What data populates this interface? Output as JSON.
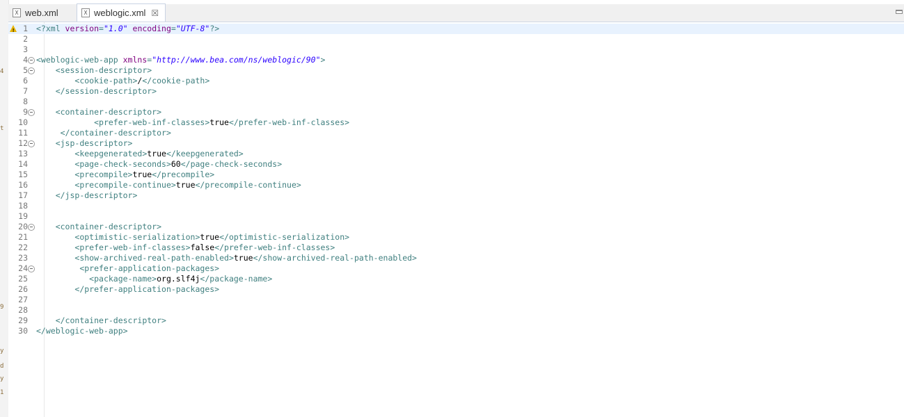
{
  "tabs": [
    {
      "label": "web.xml",
      "icon": "xml-file-icon",
      "active": false
    },
    {
      "label": "weblogic.xml",
      "icon": "xml-file-icon",
      "active": true,
      "close": "☒"
    }
  ],
  "left_strip_glyphs": [
    "4",
    "t",
    "9",
    "y",
    "d",
    "y",
    "1"
  ],
  "colors": {
    "tag": "#3f7f7f",
    "attr": "#7f007f",
    "value": "#2a00ff",
    "current_line": "#e8f2fe",
    "warning": "#e8b400"
  },
  "lines": [
    {
      "num": "1",
      "indent": "",
      "tokens": [
        [
          "pi",
          "<?xml "
        ],
        [
          "attr",
          "version"
        ],
        [
          "tag",
          "="
        ],
        [
          "val",
          "\"1.0\""
        ],
        [
          "tag",
          " "
        ],
        [
          "attr",
          "encoding"
        ],
        [
          "tag",
          "="
        ],
        [
          "val",
          "\"UTF-8\""
        ],
        [
          "pi",
          "?>"
        ]
      ]
    },
    {
      "num": "2",
      "indent": "",
      "tokens": []
    },
    {
      "num": "3",
      "indent": "",
      "tokens": []
    },
    {
      "num": "4",
      "indent": "",
      "tokens": [
        [
          "tag",
          "<weblogic-web-app "
        ],
        [
          "attr",
          "xmlns"
        ],
        [
          "tag",
          "="
        ],
        [
          "val",
          "\"http://www.bea.com/ns/weblogic/90\""
        ],
        [
          "tag",
          ">"
        ]
      ]
    },
    {
      "num": "5",
      "indent": "    ",
      "tokens": [
        [
          "tag",
          "<session-descriptor>"
        ]
      ]
    },
    {
      "num": "6",
      "indent": "        ",
      "tokens": [
        [
          "tag",
          "<cookie-path>"
        ],
        [
          "text",
          "/"
        ],
        [
          "tag",
          "</cookie-path>"
        ]
      ]
    },
    {
      "num": "7",
      "indent": "    ",
      "tokens": [
        [
          "tag",
          "</session-descriptor>"
        ]
      ]
    },
    {
      "num": "8",
      "indent": "",
      "tokens": []
    },
    {
      "num": "9",
      "indent": "    ",
      "tokens": [
        [
          "tag",
          "<container-descriptor>"
        ]
      ]
    },
    {
      "num": "10",
      "indent": "            ",
      "tokens": [
        [
          "tag",
          "<prefer-web-inf-classes>"
        ],
        [
          "text",
          "true"
        ],
        [
          "tag",
          "</prefer-web-inf-classes>"
        ]
      ]
    },
    {
      "num": "11",
      "indent": "     ",
      "tokens": [
        [
          "tag",
          "</container-descriptor>"
        ]
      ]
    },
    {
      "num": "12",
      "indent": "    ",
      "tokens": [
        [
          "tag",
          "<jsp-descriptor>"
        ]
      ]
    },
    {
      "num": "13",
      "indent": "        ",
      "tokens": [
        [
          "tag",
          "<keepgenerated>"
        ],
        [
          "text",
          "true"
        ],
        [
          "tag",
          "</keepgenerated>"
        ]
      ]
    },
    {
      "num": "14",
      "indent": "        ",
      "tokens": [
        [
          "tag",
          "<page-check-seconds>"
        ],
        [
          "text",
          "60"
        ],
        [
          "tag",
          "</page-check-seconds>"
        ]
      ]
    },
    {
      "num": "15",
      "indent": "        ",
      "tokens": [
        [
          "tag",
          "<precompile>"
        ],
        [
          "text",
          "true"
        ],
        [
          "tag",
          "</precompile>"
        ]
      ]
    },
    {
      "num": "16",
      "indent": "        ",
      "tokens": [
        [
          "tag",
          "<precompile-continue>"
        ],
        [
          "text",
          "true"
        ],
        [
          "tag",
          "</precompile-continue>"
        ]
      ]
    },
    {
      "num": "17",
      "indent": "    ",
      "tokens": [
        [
          "tag",
          "</jsp-descriptor>"
        ]
      ]
    },
    {
      "num": "18",
      "indent": "",
      "tokens": []
    },
    {
      "num": "19",
      "indent": "",
      "tokens": []
    },
    {
      "num": "20",
      "indent": "    ",
      "tokens": [
        [
          "tag",
          "<container-descriptor>"
        ]
      ]
    },
    {
      "num": "21",
      "indent": "        ",
      "tokens": [
        [
          "tag",
          "<optimistic-serialization>"
        ],
        [
          "text",
          "true"
        ],
        [
          "tag",
          "</optimistic-serialization>"
        ]
      ]
    },
    {
      "num": "22",
      "indent": "        ",
      "tokens": [
        [
          "tag",
          "<prefer-web-inf-classes>"
        ],
        [
          "text",
          "false"
        ],
        [
          "tag",
          "</prefer-web-inf-classes>"
        ]
      ]
    },
    {
      "num": "23",
      "indent": "        ",
      "tokens": [
        [
          "tag",
          "<show-archived-real-path-enabled>"
        ],
        [
          "text",
          "true"
        ],
        [
          "tag",
          "</show-archived-real-path-enabled>"
        ]
      ]
    },
    {
      "num": "24",
      "indent": "         ",
      "tokens": [
        [
          "tag",
          "<prefer-application-packages>"
        ]
      ]
    },
    {
      "num": "25",
      "indent": "           ",
      "tokens": [
        [
          "tag",
          "<package-name>"
        ],
        [
          "text",
          "org.slf4j"
        ],
        [
          "tag",
          "</package-name>"
        ]
      ]
    },
    {
      "num": "26",
      "indent": "        ",
      "tokens": [
        [
          "tag",
          "</prefer-application-packages>"
        ]
      ]
    },
    {
      "num": "27",
      "indent": "",
      "tokens": []
    },
    {
      "num": "28",
      "indent": "",
      "tokens": []
    },
    {
      "num": "29",
      "indent": "    ",
      "tokens": [
        [
          "tag",
          "</container-descriptor>"
        ]
      ]
    },
    {
      "num": "30",
      "indent": "",
      "tokens": [
        [
          "tag",
          "</weblogic-web-app>"
        ]
      ]
    }
  ],
  "fold_lines": [
    "4",
    "5",
    "9",
    "12",
    "20",
    "24"
  ],
  "warning_line": "1",
  "current_line": "1"
}
